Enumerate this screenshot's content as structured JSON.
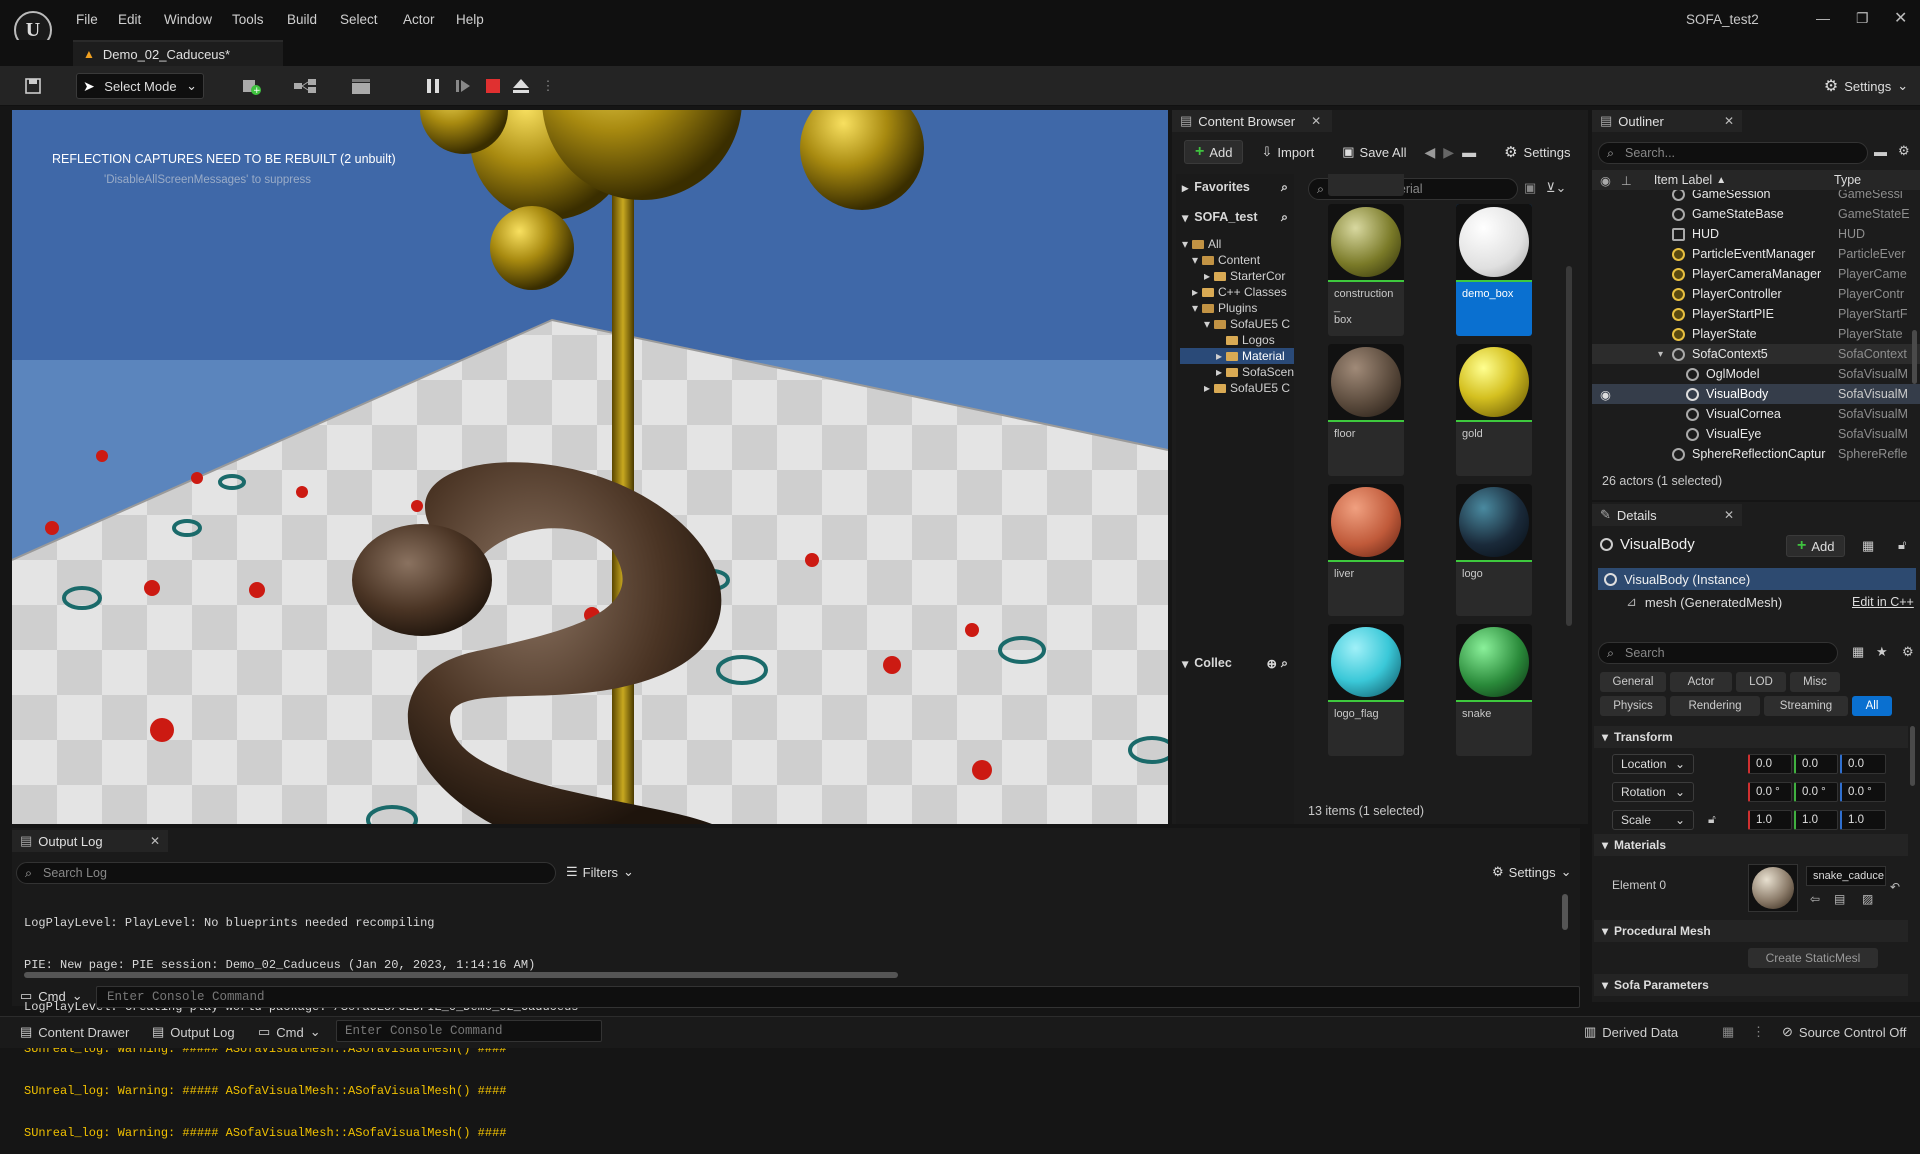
{
  "menu": [
    "File",
    "Edit",
    "Window",
    "Tools",
    "Build",
    "Select",
    "Actor",
    "Help"
  ],
  "app_title": "SOFA_test2",
  "level_tab": "Demo_02_Caduceus*",
  "toolbar": {
    "select_mode": "Select Mode",
    "settings": "Settings"
  },
  "viewport": {
    "rebuild_message": "REFLECTION CAPTURES NEED TO BE REBUILT (2 unbuilt)",
    "suppress_message": "'DisableAllScreenMessages' to suppress"
  },
  "content_browser": {
    "tab": "Content Browser",
    "add": "Add",
    "import": "Import",
    "save_all": "Save All",
    "settings": "Settings",
    "favorites": "Favorites",
    "project": "SOFA_test",
    "collections": "Collec",
    "search_placeholder": "Search Material",
    "tree": [
      "All",
      "Content",
      "StarterCor",
      "C++ Classes",
      "Plugins",
      "SofaUE5 C",
      "Logos",
      "Material",
      "SofaScen",
      "SofaUE5 C"
    ],
    "assets": [
      {
        "name": "construction_\nbox",
        "color": "#8a8a30"
      },
      {
        "name": "demo_box",
        "color": "#f0f0f0"
      },
      {
        "name": "floor",
        "color": "#5a4a3c"
      },
      {
        "name": "gold",
        "color": "#d4c020"
      },
      {
        "name": "liver",
        "color": "#c05a3a"
      },
      {
        "name": "logo",
        "color": "#1a2a3a"
      },
      {
        "name": "logo_flag",
        "color": "#3ac8d8"
      },
      {
        "name": "snake",
        "color": "#2a8a3a"
      }
    ],
    "status": "13 items (1 selected)"
  },
  "outliner": {
    "tab": "Outliner",
    "search_placeholder": "Search...",
    "col_label": "Item Label",
    "col_type": "Type",
    "rows": [
      {
        "label": "GameSession",
        "type": "GameSessi"
      },
      {
        "label": "GameStateBase",
        "type": "GameStateE"
      },
      {
        "label": "HUD",
        "type": "HUD"
      },
      {
        "label": "ParticleEventManager",
        "type": "ParticleEver"
      },
      {
        "label": "PlayerCameraManager",
        "type": "PlayerCame"
      },
      {
        "label": "PlayerController",
        "type": "PlayerContr"
      },
      {
        "label": "PlayerStartPIE",
        "type": "PlayerStartF"
      },
      {
        "label": "PlayerState",
        "type": "PlayerState"
      },
      {
        "label": "SofaContext5",
        "type": "SofaContext"
      },
      {
        "label": "OglModel",
        "type": "SofaVisualM"
      },
      {
        "label": "VisualBody",
        "type": "SofaVisualM"
      },
      {
        "label": "VisualCornea",
        "type": "SofaVisualM"
      },
      {
        "label": "VisualEye",
        "type": "SofaVisualM"
      },
      {
        "label": "SphereReflectionCaptur",
        "type": "SphereRefle"
      }
    ],
    "status": "26 actors (1 selected)"
  },
  "details": {
    "tab": "Details",
    "actor": "VisualBody",
    "add": "Add",
    "instance": "VisualBody (Instance)",
    "component": "mesh (GeneratedMesh)",
    "edit_cpp": "Edit in C++",
    "search_placeholder": "Search",
    "filters": [
      "General",
      "Actor",
      "LOD",
      "Misc",
      "Physics",
      "Rendering",
      "Streaming",
      "All"
    ],
    "transform": "Transform",
    "location": {
      "label": "Location",
      "values": [
        "0.0",
        "0.0",
        "0.0"
      ]
    },
    "rotation": {
      "label": "Rotation",
      "values": [
        "0.0 °",
        "0.0 °",
        "0.0 °"
      ]
    },
    "scale": {
      "label": "Scale",
      "values": [
        "1.0",
        "1.0",
        "1.0"
      ]
    },
    "materials": "Materials",
    "element0": "Element 0",
    "material_name": "snake_caduce",
    "procedural_mesh": "Procedural Mesh",
    "create_static": "Create StaticMesl",
    "sofa_params": "Sofa Parameters"
  },
  "output_log": {
    "tab": "Output Log",
    "search_placeholder": "Search Log",
    "filters": "Filters",
    "settings": "Settings",
    "lines": [
      {
        "text": "LogPlayLevel: PlayLevel: No blueprints needed recompiling",
        "warn": false
      },
      {
        "text": "PIE: New page: PIE session: Demo_02_Caduceus (Jan 20, 2023, 1:14:16 AM)",
        "warn": false
      },
      {
        "text": "LogPlayLevel: Creating play world package: /SofaUE5/UEDPIE_0_Demo_02_Caduceus",
        "warn": false
      },
      {
        "text": "SUnreal_log: Warning: ##### ASofaVisualMesh::ASofaVisualMesh() ####",
        "warn": true
      },
      {
        "text": "SUnreal_log: Warning: ##### ASofaVisualMesh::ASofaVisualMesh() ####",
        "warn": true
      },
      {
        "text": "SUnreal_log: Warning: ##### ASofaVisualMesh::ASofaVisualMesh() ####",
        "warn": true
      }
    ],
    "cmd": "Cmd",
    "console_placeholder": "Enter Console Command"
  },
  "statusbar": {
    "content_drawer": "Content Drawer",
    "output_log": "Output Log",
    "cmd": "Cmd",
    "console_placeholder": "Enter Console Command",
    "derived_data": "Derived Data",
    "source_control": "Source Control Off"
  }
}
